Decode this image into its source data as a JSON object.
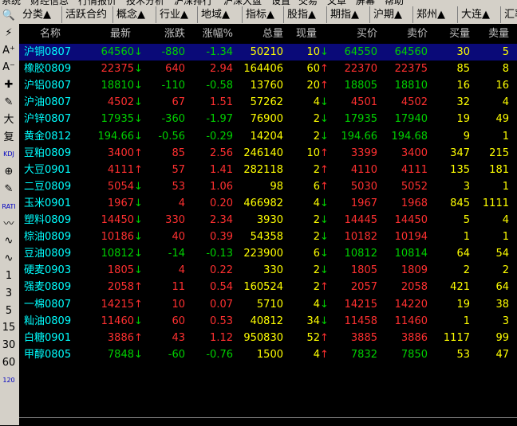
{
  "menu": [
    "系统",
    "财经信息",
    "行情报价",
    "技术分析",
    "沪深排行",
    "沪深大盘",
    "设置",
    "交易",
    "文章",
    "屏幕",
    "帮助"
  ],
  "tabs": [
    "分类▲",
    "活跃合约",
    "概念▲",
    "行业▲",
    "地域▲",
    "指标▲",
    "股指▲",
    "期指▲",
    "沪期▲",
    "郑州▲",
    "大连▲",
    "汇率"
  ],
  "toolbar": [
    "🔍",
    "⚡",
    "A⁺",
    "A⁻",
    "✚",
    "✎",
    "大",
    "复",
    "KDJ",
    "⊕",
    "✎",
    "RATI",
    "〰",
    "∿",
    "∿",
    "1",
    "3",
    "5",
    "15",
    "30",
    "60",
    "120"
  ],
  "columns": [
    "名称",
    "最新",
    "涨跌",
    "涨幅%",
    "总量",
    "现量",
    "买价",
    "卖价",
    "买量",
    "卖量"
  ],
  "colors": {
    "up": "#ff3030",
    "down": "#00d000"
  },
  "rows": [
    {
      "name": "沪铜0807",
      "last": "64560",
      "arrow": "down",
      "chg": "-880",
      "pct": "-1.34",
      "vol": "50210",
      "cur": "10",
      "cdir": "down",
      "bid": "64550",
      "ask": "64560",
      "bv": "30",
      "av": "5"
    },
    {
      "name": "橡胶0809",
      "last": "22375",
      "arrow": "down",
      "chg": "640",
      "pct": "2.94",
      "vol": "164406",
      "cur": "60",
      "cdir": "up",
      "bid": "22370",
      "ask": "22375",
      "bv": "85",
      "av": "8"
    },
    {
      "name": "沪铝0807",
      "last": "18810",
      "arrow": "down",
      "chg": "-110",
      "pct": "-0.58",
      "vol": "13760",
      "cur": "20",
      "cdir": "up",
      "bid": "18805",
      "ask": "18810",
      "bv": "16",
      "av": "16"
    },
    {
      "name": "沪油0807",
      "last": "4502",
      "arrow": "down",
      "chg": "67",
      "pct": "1.51",
      "vol": "57262",
      "cur": "4",
      "cdir": "down",
      "bid": "4501",
      "ask": "4502",
      "bv": "32",
      "av": "4"
    },
    {
      "name": "沪锌0807",
      "last": "17935",
      "arrow": "down",
      "chg": "-360",
      "pct": "-1.97",
      "vol": "76900",
      "cur": "2",
      "cdir": "down",
      "bid": "17935",
      "ask": "17940",
      "bv": "19",
      "av": "49"
    },
    {
      "name": "黄金0812",
      "last": "194.66",
      "arrow": "down",
      "chg": "-0.56",
      "pct": "-0.29",
      "vol": "14204",
      "cur": "2",
      "cdir": "down",
      "bid": "194.66",
      "ask": "194.68",
      "bv": "9",
      "av": "1"
    },
    {
      "name": "豆粕0809",
      "last": "3400",
      "arrow": "up",
      "chg": "85",
      "pct": "2.56",
      "vol": "246140",
      "cur": "10",
      "cdir": "up",
      "bid": "3399",
      "ask": "3400",
      "bv": "347",
      "av": "215"
    },
    {
      "name": "大豆0901",
      "last": "4111",
      "arrow": "up",
      "chg": "57",
      "pct": "1.41",
      "vol": "282118",
      "cur": "2",
      "cdir": "up",
      "bid": "4110",
      "ask": "4111",
      "bv": "135",
      "av": "181"
    },
    {
      "name": "二豆0809",
      "last": "5054",
      "arrow": "down",
      "chg": "53",
      "pct": "1.06",
      "vol": "98",
      "cur": "6",
      "cdir": "up",
      "bid": "5030",
      "ask": "5052",
      "bv": "3",
      "av": "1"
    },
    {
      "name": "玉米0901",
      "last": "1967",
      "arrow": "down",
      "chg": "4",
      "pct": "0.20",
      "vol": "466982",
      "cur": "4",
      "cdir": "down",
      "bid": "1967",
      "ask": "1968",
      "bv": "845",
      "av": "1111"
    },
    {
      "name": "塑料0809",
      "last": "14450",
      "arrow": "down",
      "chg": "330",
      "pct": "2.34",
      "vol": "3930",
      "cur": "2",
      "cdir": "down",
      "bid": "14445",
      "ask": "14450",
      "bv": "5",
      "av": "4"
    },
    {
      "name": "棕油0809",
      "last": "10186",
      "arrow": "down",
      "chg": "40",
      "pct": "0.39",
      "vol": "54358",
      "cur": "2",
      "cdir": "down",
      "bid": "10182",
      "ask": "10194",
      "bv": "1",
      "av": "1"
    },
    {
      "name": "豆油0809",
      "last": "10812",
      "arrow": "down",
      "chg": "-14",
      "pct": "-0.13",
      "vol": "223900",
      "cur": "6",
      "cdir": "down",
      "bid": "10812",
      "ask": "10814",
      "bv": "64",
      "av": "54"
    },
    {
      "name": "硬麦0903",
      "last": "1805",
      "arrow": "down",
      "chg": "4",
      "pct": "0.22",
      "vol": "330",
      "cur": "2",
      "cdir": "down",
      "bid": "1805",
      "ask": "1809",
      "bv": "2",
      "av": "2"
    },
    {
      "name": "强麦0809",
      "last": "2058",
      "arrow": "up",
      "chg": "11",
      "pct": "0.54",
      "vol": "160524",
      "cur": "2",
      "cdir": "up",
      "bid": "2057",
      "ask": "2058",
      "bv": "421",
      "av": "64"
    },
    {
      "name": "一棉0807",
      "last": "14215",
      "arrow": "up",
      "chg": "10",
      "pct": "0.07",
      "vol": "5710",
      "cur": "4",
      "cdir": "down",
      "bid": "14215",
      "ask": "14220",
      "bv": "19",
      "av": "38"
    },
    {
      "name": "籼油0809",
      "last": "11460",
      "arrow": "down",
      "chg": "60",
      "pct": "0.53",
      "vol": "40812",
      "cur": "34",
      "cdir": "down",
      "bid": "11458",
      "ask": "11460",
      "bv": "1",
      "av": "3"
    },
    {
      "name": "白糖0901",
      "last": "3886",
      "arrow": "up",
      "chg": "43",
      "pct": "1.12",
      "vol": "950830",
      "cur": "52",
      "cdir": "up",
      "bid": "3885",
      "ask": "3886",
      "bv": "1117",
      "av": "99"
    },
    {
      "name": "甲醇0805",
      "last": "7848",
      "arrow": "down",
      "chg": "-60",
      "pct": "-0.76",
      "vol": "1500",
      "cur": "4",
      "cdir": "up",
      "bid": "7832",
      "ask": "7850",
      "bv": "53",
      "av": "47"
    }
  ]
}
